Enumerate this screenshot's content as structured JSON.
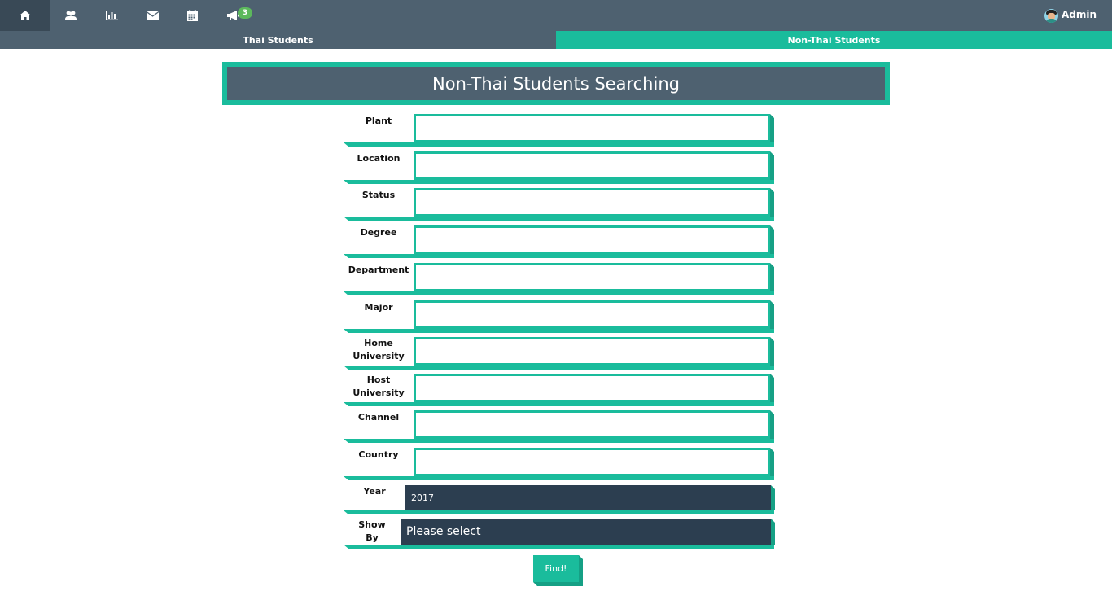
{
  "nav": {
    "badge_count": "3",
    "admin_label": "Admin",
    "icons": [
      "home-icon",
      "users-icon",
      "bar-chart-icon",
      "envelope-icon",
      "calendar-icon",
      "bullhorn-icon"
    ]
  },
  "tabs": {
    "thai": "Thai Students",
    "non_thai": "Non-Thai Students",
    "active": "non_thai"
  },
  "page_title": "Non-Thai Students Searching",
  "form": {
    "fields": [
      {
        "label": "Plant",
        "value": ""
      },
      {
        "label": "Location",
        "value": ""
      },
      {
        "label": "Status",
        "value": ""
      },
      {
        "label": "Degree",
        "value": ""
      },
      {
        "label": "Department",
        "value": ""
      },
      {
        "label": "Major",
        "value": ""
      },
      {
        "label": "Home University",
        "value": ""
      },
      {
        "label": "Host University",
        "value": ""
      },
      {
        "label": "Channel",
        "value": ""
      },
      {
        "label": "Country",
        "value": ""
      }
    ],
    "year_label": "Year",
    "year_value": "2017",
    "show_by_label": "Show By",
    "show_by_value": "Please select",
    "find_label": "Find!"
  },
  "colors": {
    "nav_bg": "#4e6170",
    "accent": "#1abc9c",
    "select_bg": "#2c3e50",
    "badge": "#5cb85c"
  }
}
